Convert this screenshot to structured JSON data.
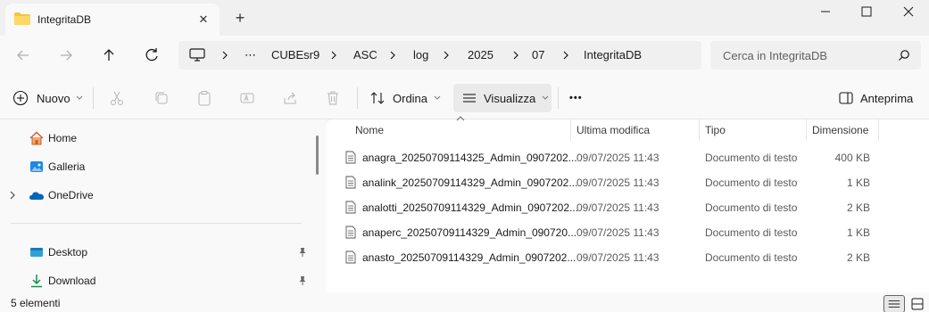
{
  "window": {
    "tab_title": "IntegritaDB",
    "tab_close_glyph": "✕",
    "new_tab_glyph": "+"
  },
  "address": {
    "crumbs": [
      "⋯",
      "CUBEsr9",
      "ASC",
      "log",
      "2025",
      "07",
      "IntegritaDB"
    ],
    "search_placeholder": "Cerca in IntegritaDB"
  },
  "toolbar": {
    "new_label": "Nuovo",
    "sort_label": "Ordina",
    "view_label": "Visualizza",
    "more_label": "•••",
    "preview_label": "Anteprima"
  },
  "sidebar": {
    "items": [
      {
        "label": "Home",
        "icon": "home-icon"
      },
      {
        "label": "Galleria",
        "icon": "gallery-icon"
      },
      {
        "label": "OneDrive",
        "icon": "onedrive-icon"
      },
      {
        "label": "Desktop",
        "icon": "desktop-icon"
      },
      {
        "label": "Download",
        "icon": "download-icon"
      }
    ]
  },
  "columns": {
    "name": "Nome",
    "modified": "Ultima modifica",
    "type": "Tipo",
    "size": "Dimensione"
  },
  "files": [
    {
      "name": "anagra_20250709114325_Admin_0907202...",
      "modified": "09/07/2025 11:43",
      "type": "Documento di testo",
      "size": "400 KB"
    },
    {
      "name": "analink_20250709114329_Admin_0907202...",
      "modified": "09/07/2025 11:43",
      "type": "Documento di testo",
      "size": "1 KB"
    },
    {
      "name": "analotti_20250709114329_Admin_0907202...",
      "modified": "09/07/2025 11:43",
      "type": "Documento di testo",
      "size": "2 KB"
    },
    {
      "name": "anaperc_20250709114329_Admin_090720...",
      "modified": "09/07/2025 11:43",
      "type": "Documento di testo",
      "size": "1 KB"
    },
    {
      "name": "anasto_20250709114329_Admin_0907202...",
      "modified": "09/07/2025 11:43",
      "type": "Documento di testo",
      "size": "2 KB"
    }
  ],
  "status": {
    "count_text": "5 elementi"
  },
  "colors": {
    "folder": "#f4c542",
    "accent": "#0067c0",
    "onedrive": "#0364b8"
  }
}
